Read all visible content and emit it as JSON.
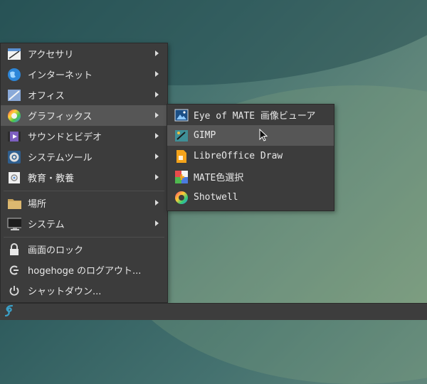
{
  "main_menu": {
    "items": [
      {
        "label": "アクセサリ",
        "icon": "accessories-icon",
        "has_submenu": true
      },
      {
        "label": "インターネット",
        "icon": "internet-globe-icon",
        "has_submenu": true
      },
      {
        "label": "オフィス",
        "icon": "office-icon",
        "has_submenu": true
      },
      {
        "label": "グラフィックス",
        "icon": "graphics-icon",
        "has_submenu": true,
        "active": true
      },
      {
        "label": "サウンドとビデオ",
        "icon": "sound-video-icon",
        "has_submenu": true
      },
      {
        "label": "システムツール",
        "icon": "system-tools-icon",
        "has_submenu": true
      },
      {
        "label": "教育・教養",
        "icon": "education-icon",
        "has_submenu": true
      },
      {
        "label": "場所",
        "icon": "places-folder-icon",
        "has_submenu": true
      },
      {
        "label": "システム",
        "icon": "system-monitor-icon",
        "has_submenu": true
      },
      {
        "label": "画面のロック",
        "icon": "lock-icon",
        "has_submenu": false
      },
      {
        "label": "hogehoge のログアウト...",
        "icon": "logout-icon",
        "has_submenu": false
      },
      {
        "label": "シャットダウン...",
        "icon": "power-icon",
        "has_submenu": false
      }
    ]
  },
  "graphics_submenu": {
    "items": [
      {
        "label": "Eye of MATE 画像ビューア",
        "icon": "image-viewer-icon"
      },
      {
        "label": "GIMP",
        "icon": "gimp-icon",
        "hover": true
      },
      {
        "label": "LibreOffice Draw",
        "icon": "libreoffice-draw-icon"
      },
      {
        "label": "MATE色選択",
        "icon": "color-picker-icon"
      },
      {
        "label": "Shotwell",
        "icon": "shotwell-icon"
      }
    ]
  },
  "colors": {
    "menu_bg": "#3c3c3c",
    "highlight": "#565656",
    "text": "#e8e8e8",
    "panel_bg": "#3d3d3d",
    "accent": "#3aa0c8"
  }
}
